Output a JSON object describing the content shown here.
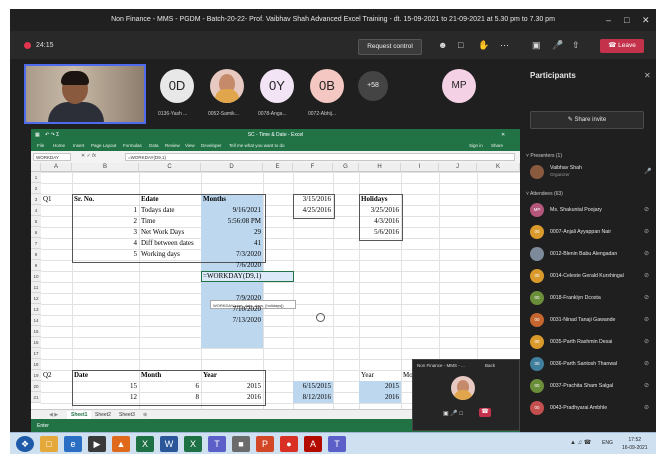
{
  "window": {
    "title": "Non Finance - MMS - PGDM - Batch-20-22- Prof. Vaibhav Shah Advanced Excel Training - dt. 15-09-2021 to 21-09-2021 at 5.30 pm to 7.30 pm"
  },
  "toolbar": {
    "timer": "24:15",
    "request_control": "Request control",
    "leave": "Leave"
  },
  "video": {
    "name": "Vaibhav Shah"
  },
  "strip": [
    {
      "initials": "0D",
      "name": "0136-Yash ...",
      "color": "#e8e8e8"
    },
    {
      "initials": "",
      "name": "0052-Samik...",
      "color": "#e8c9c2"
    },
    {
      "initials": "0Y",
      "name": "0078-Anga...",
      "color": "#f2e4f5"
    },
    {
      "initials": "0B",
      "name": "0072-Abhij...",
      "color": "#f4c7c2"
    },
    {
      "initials": "+58",
      "name": "",
      "color": "#444444"
    },
    {
      "initials": "MP",
      "name": "",
      "color": "#f4d1e4"
    }
  ],
  "excel": {
    "title": "SC - Time & Date - Excel",
    "ribbon": [
      "File",
      "Home",
      "Insert",
      "Page Layout",
      "Formulas",
      "Data",
      "Review",
      "View",
      "Developer",
      "Tell me what you want to do"
    ],
    "signin": "Sign in",
    "share": "Share",
    "namebox": "WORKDAY",
    "formula": "=WORKDAY(D9,1)",
    "columns": [
      "A",
      "B",
      "C",
      "D",
      "E",
      "F",
      "G",
      "H",
      "I",
      "J",
      "K"
    ],
    "rows": [
      "1",
      "2",
      "3",
      "4",
      "5",
      "6",
      "7",
      "8",
      "9",
      "10",
      "11",
      "12",
      "13",
      "14",
      "15",
      "16",
      "17",
      "18",
      "19",
      "20",
      "21"
    ],
    "cells": {
      "a3": "Q1",
      "b3": "Sr. No.",
      "c3": "Edate",
      "d3": "Months",
      "f3": "3/15/2016",
      "h3": "Holidays",
      "b4": "1",
      "c4": "Todays date",
      "d4": "9/16/2021",
      "f4": "4/25/2016",
      "h4": "3/25/2016",
      "b5": "2",
      "c5": "Time",
      "d5": "5:56:08 PM",
      "h5": "4/3/2016",
      "b6": "3",
      "c6": "Net Work Days",
      "d6": "29",
      "h6": "5/6/2016",
      "b7": "4",
      "c7": "Diff between dates",
      "d7": "41",
      "b8": "5",
      "c8": "Working days",
      "d8": "7/3/2020",
      "d9": "7/6/2020",
      "d10": "=WORKDAY(D9,1)",
      "tooltip": "WORKDAY(start_date, days, [holidays])",
      "d12": "7/9/2020",
      "d13": "7/10/2020",
      "d14": "7/13/2020",
      "a18": "Q2",
      "b18": "Date",
      "c18": "Month",
      "d18": "Year",
      "h18": "Year",
      "i18": "Month",
      "b19": "15",
      "c19": "6",
      "d19": "2015",
      "f19": "6/15/2015",
      "h19": "2015",
      "b20": "12",
      "c20": "8",
      "d20": "2016",
      "f20": "8/12/2016",
      "h20": "2016"
    },
    "sheets": [
      "Sheet1",
      "Sheet2",
      "Sheet3"
    ],
    "status": "Enter"
  },
  "pip": {
    "title": "Non Finance - MMS - ...",
    "label": "Back"
  },
  "panel": {
    "title": "Participants",
    "share_invite": "Share invite",
    "presenters_header": "Presenters (1)",
    "presenter": {
      "name": "Vaibhav Shah",
      "role": "Organizer"
    },
    "attendees_header": "Attendees (63)",
    "attendees": [
      {
        "initials": "MP",
        "name": "Ms. Shakuntal Poojary",
        "color": "#b4577a"
      },
      {
        "initials": "00",
        "name": "0007-Anjali Ayyappan Nair",
        "color": "#d99a2b"
      },
      {
        "initials": "",
        "name": "0012-Blenin Babu Alengadan",
        "color": "#7c8a99"
      },
      {
        "initials": "00",
        "name": "0014-Celeste Gerald Kurshingal",
        "color": "#d99a2b"
      },
      {
        "initials": "00",
        "name": "0018-Franklyn Dcosta",
        "color": "#6b8e3a"
      },
      {
        "initials": "00",
        "name": "0031-Ninad Tanaji Gawande",
        "color": "#c4662e"
      },
      {
        "initials": "00",
        "name": "0035-Parth Rashmin Desai",
        "color": "#d99a2b"
      },
      {
        "initials": "00",
        "name": "0036-Parth Santosh Thanwal",
        "color": "#3f7e9c"
      },
      {
        "initials": "00",
        "name": "0037-Prachita Sham Salgal",
        "color": "#6b8e3a"
      },
      {
        "initials": "00",
        "name": "0043-Pradhyarai Ambhle",
        "color": "#c44f4f"
      }
    ]
  },
  "taskbar": {
    "time": "17:52",
    "date": "16-09-2021",
    "lang": "ENG"
  }
}
